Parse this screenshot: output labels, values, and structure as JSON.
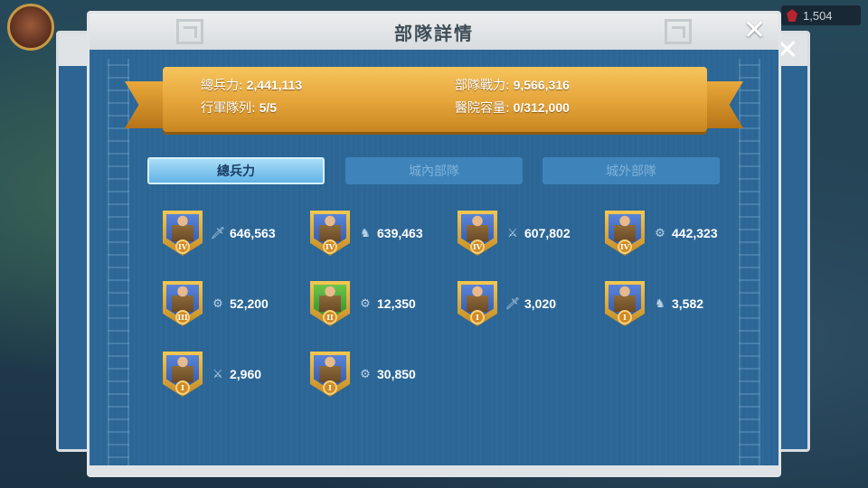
{
  "hud": {
    "gem_count": "1,504"
  },
  "dialog": {
    "title": "部隊詳情"
  },
  "summary": {
    "total_troops_label": "總兵力:",
    "total_troops_value": "2,441,113",
    "march_queue_label": "行軍隊列:",
    "march_queue_value": "5/5",
    "troop_power_label": "部隊戰力:",
    "troop_power_value": "9,566,316",
    "hospital_label": "醫院容量:",
    "hospital_value": "0/312,000"
  },
  "tabs": [
    {
      "label": "總兵力",
      "active": true
    },
    {
      "label": "城內部隊",
      "active": false
    },
    {
      "label": "城外部隊",
      "active": false
    }
  ],
  "troops": [
    {
      "tier": "IV",
      "type": "infantry",
      "type_icon": "sword-icon",
      "count": "646,563",
      "frame": "blue"
    },
    {
      "tier": "IV",
      "type": "cavalry",
      "type_icon": "horse-icon",
      "count": "639,463",
      "frame": "blue"
    },
    {
      "tier": "IV",
      "type": "archer",
      "type_icon": "bow-icon",
      "count": "607,802",
      "frame": "blue"
    },
    {
      "tier": "IV",
      "type": "siege",
      "type_icon": "siege-icon",
      "count": "442,323",
      "frame": "blue"
    },
    {
      "tier": "III",
      "type": "siege",
      "type_icon": "siege-icon",
      "count": "52,200",
      "frame": "blue"
    },
    {
      "tier": "II",
      "type": "siege",
      "type_icon": "siege-icon",
      "count": "12,350",
      "frame": "green"
    },
    {
      "tier": "I",
      "type": "infantry",
      "type_icon": "sword-icon",
      "count": "3,020",
      "frame": "blue"
    },
    {
      "tier": "I",
      "type": "cavalry",
      "type_icon": "horse-icon",
      "count": "3,582",
      "frame": "blue"
    },
    {
      "tier": "I",
      "type": "archer",
      "type_icon": "bow-icon",
      "count": "2,960",
      "frame": "blue"
    },
    {
      "tier": "I",
      "type": "siege",
      "type_icon": "siege-icon",
      "count": "30,850",
      "frame": "blue"
    }
  ],
  "colors": {
    "panel_blue": "#2a6394",
    "ribbon_gold": "#e4a43a",
    "tab_active": "#62b3e6",
    "tab_inactive": "#3e84bb"
  }
}
